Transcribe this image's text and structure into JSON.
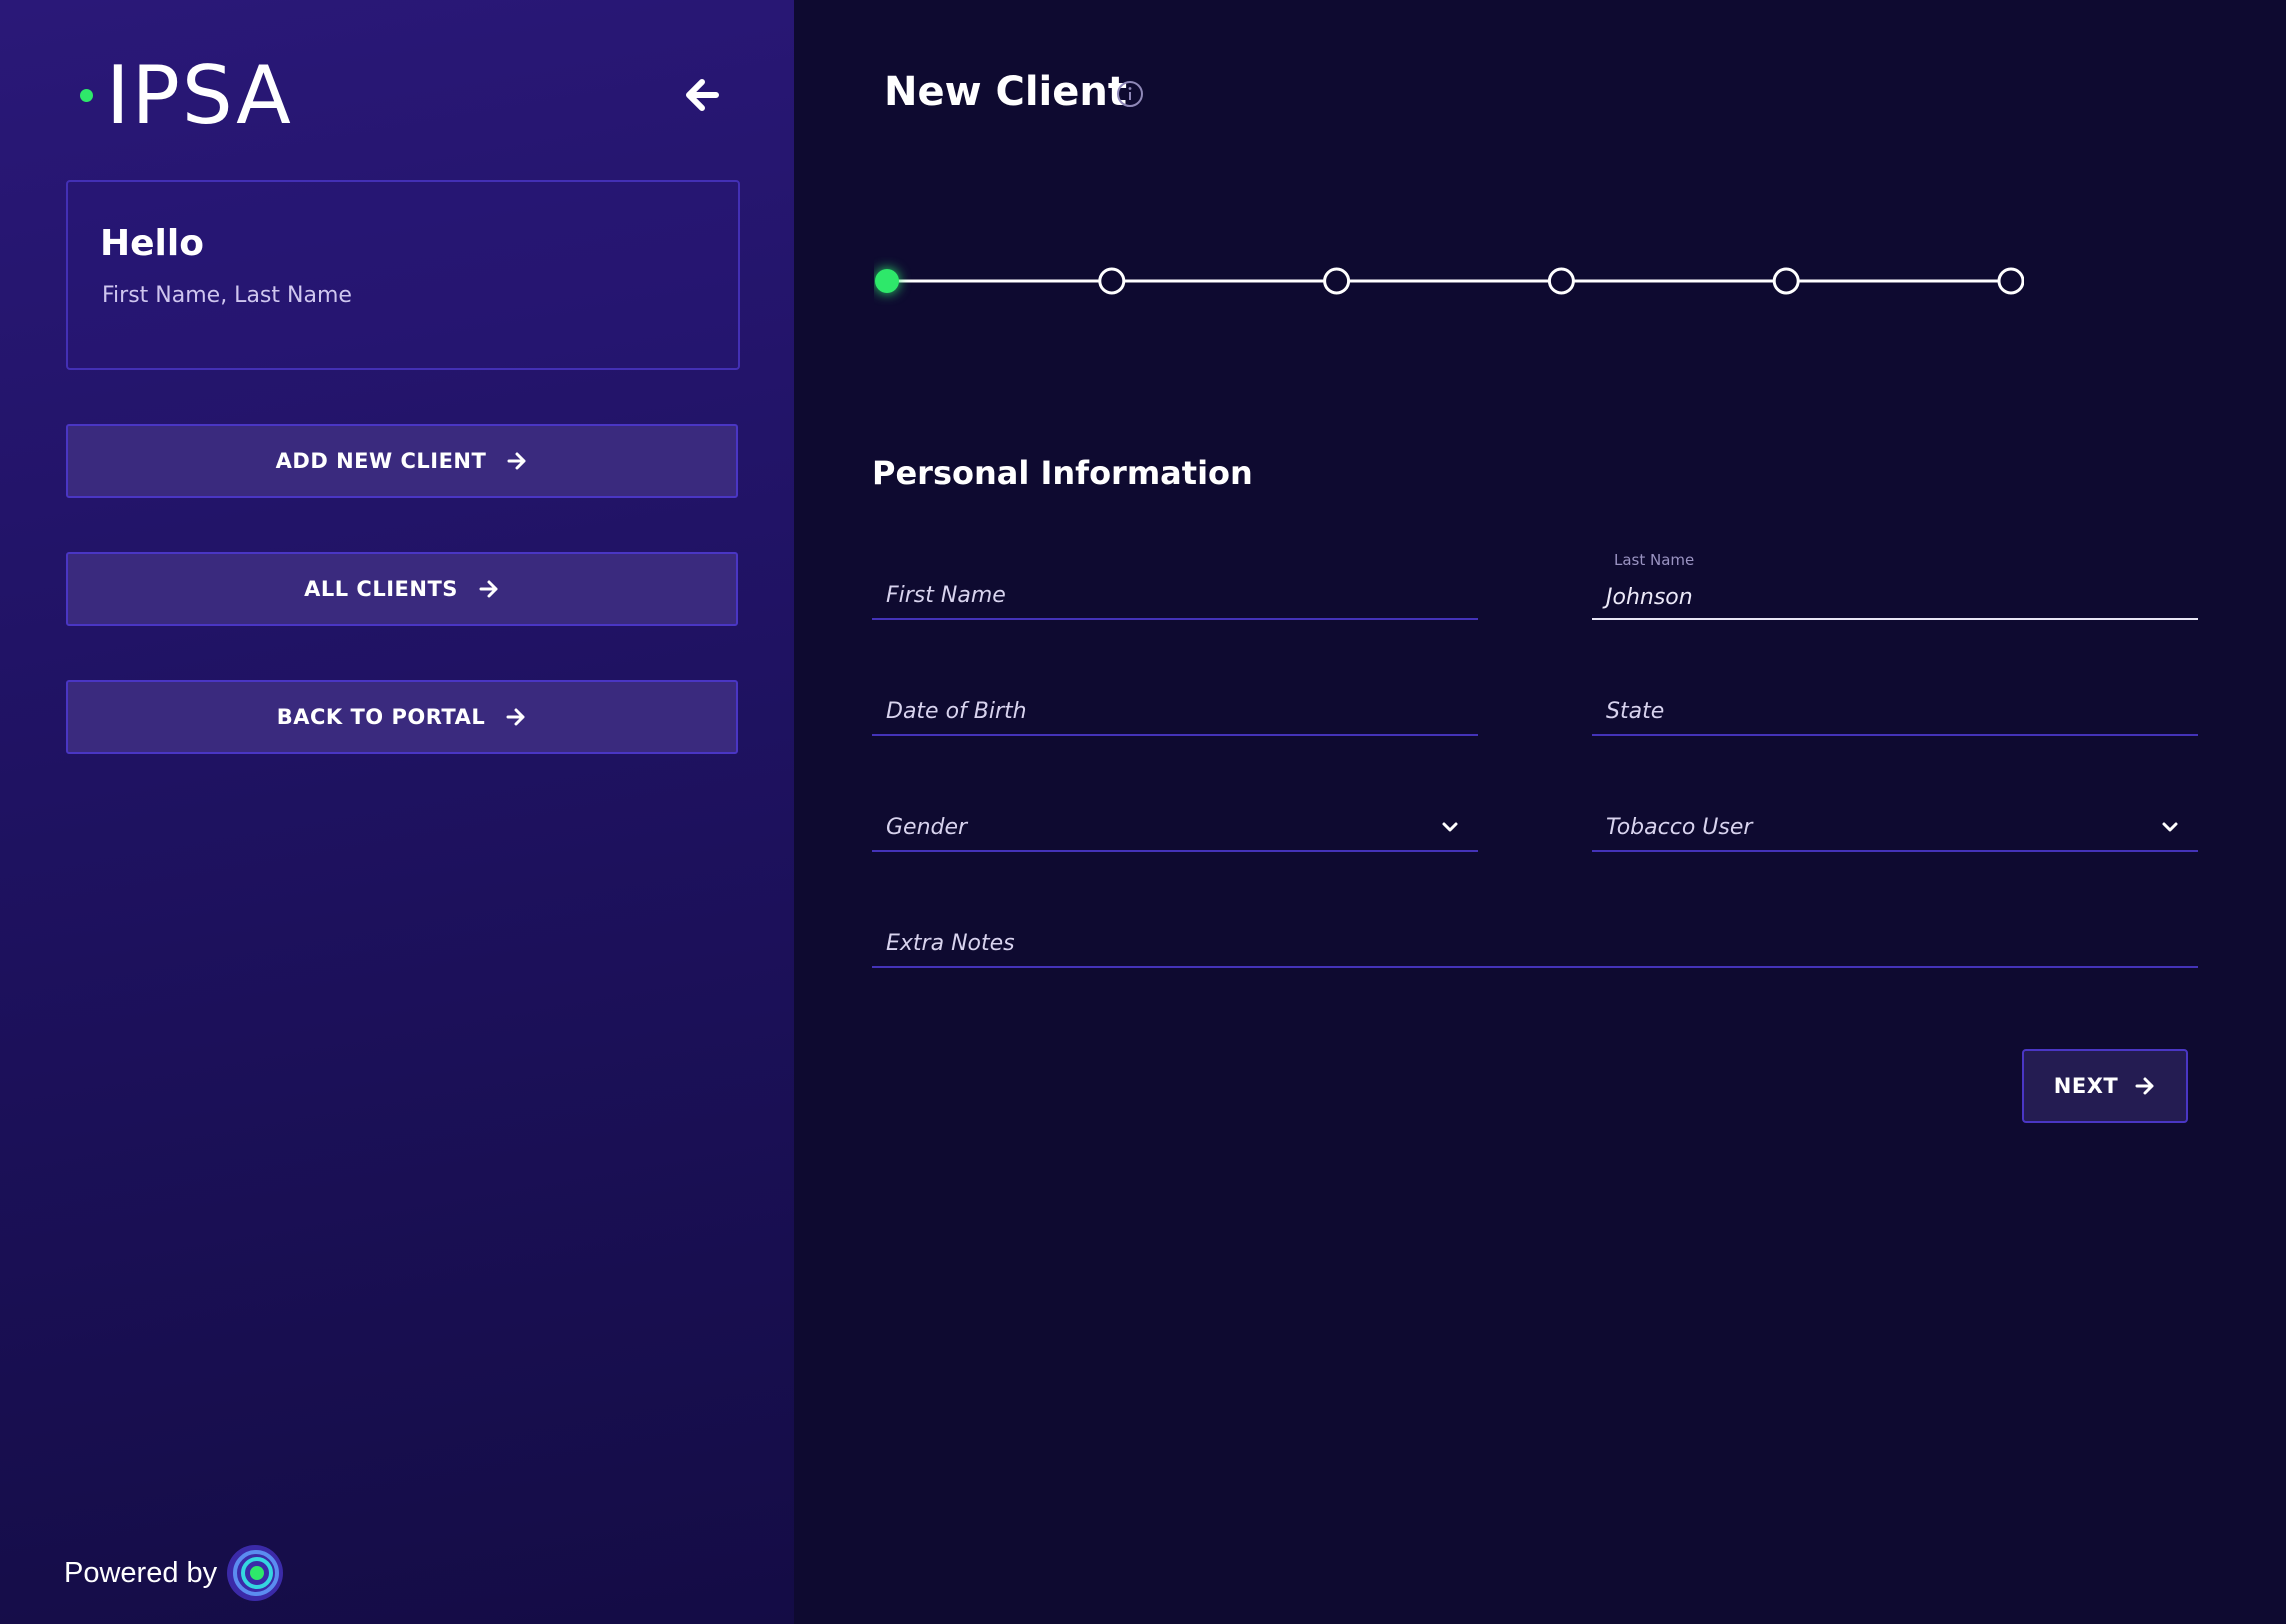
{
  "sidebar": {
    "logo": "IPSA",
    "greeting": {
      "title": "Hello",
      "name": "First Name, Last Name"
    },
    "buttons": [
      {
        "label": "ADD NEW CLIENT",
        "icon": "arrow-right-icon"
      },
      {
        "label": "ALL CLIENTS",
        "icon": "arrow-right-icon"
      },
      {
        "label": "BACK TO PORTAL",
        "icon": "arrow-right-icon"
      }
    ],
    "collapse_icon": "arrow-left-icon",
    "powered_by": "Powered by"
  },
  "main": {
    "title": "New Client",
    "info_icon": "info-icon",
    "stepper": {
      "total_steps": 6,
      "current_step": 1
    },
    "section_title": "Personal Information",
    "fields": {
      "first_name": {
        "placeholder": "First Name",
        "value": ""
      },
      "last_name": {
        "label": "Last Name",
        "value": "Johnson"
      },
      "date_of_birth": {
        "placeholder": "Date of Birth",
        "value": ""
      },
      "state": {
        "placeholder": "State",
        "value": ""
      },
      "gender": {
        "placeholder": "Gender",
        "value": ""
      },
      "tobacco_user": {
        "placeholder": "Tobacco User",
        "value": ""
      },
      "extra_notes": {
        "placeholder": "Extra Notes",
        "value": ""
      }
    },
    "next_button": {
      "label": "NEXT"
    }
  },
  "colors": {
    "accent_green": "#2ee86a",
    "sidebar_bg": "#22146a",
    "main_bg": "#0e0a30",
    "button_bg": "#3a2a7e",
    "button_border": "#4a36c4",
    "field_underline": "#4433b8"
  }
}
